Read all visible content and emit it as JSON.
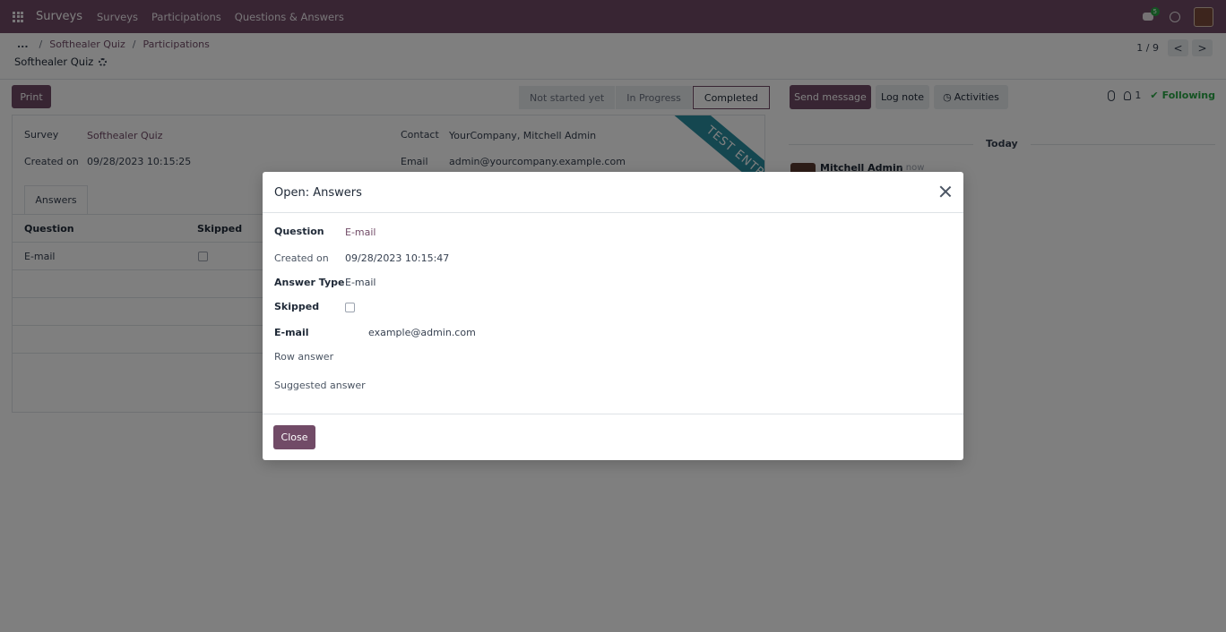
{
  "navbar": {
    "brand": "Surveys",
    "menu": [
      "Surveys",
      "Participations",
      "Questions & Answers"
    ],
    "messages_badge": "5"
  },
  "breadcrumb": {
    "dots": "...",
    "items": [
      "Softhealer Quiz",
      "Participations"
    ]
  },
  "record": {
    "title": "Softhealer Quiz"
  },
  "pager": {
    "value": "1 / 9",
    "prev": "<",
    "next": ">"
  },
  "actions": {
    "print": "Print"
  },
  "statusbar": {
    "stages": [
      "Not started yet",
      "In Progress",
      "Completed"
    ],
    "active": "Completed"
  },
  "form": {
    "survey_label": "Survey",
    "survey_value": "Softhealer Quiz",
    "created_label": "Created on",
    "created_value": "09/28/2023 10:15:25",
    "contact_label": "Contact",
    "contact_value": "YourCompany, Mitchell Admin",
    "email_label": "Email",
    "email_value": "admin@yourcompany.example.com",
    "ribbon": "TEST ENTRY",
    "tab": "Answers",
    "table": {
      "headers": [
        "Question",
        "Skipped"
      ],
      "rows": [
        {
          "question": "E-mail",
          "skipped": false
        }
      ]
    }
  },
  "chatter": {
    "send_message": "Send message",
    "log_note": "Log note",
    "activities": "Activities",
    "followers": "1",
    "following": "Following",
    "today": "Today",
    "author": "Mitchell Admin",
    "time": "- now"
  },
  "modal": {
    "title": "Open: Answers",
    "question_label": "Question",
    "question_value": "E-mail",
    "created_label": "Created on",
    "created_value": "09/28/2023 10:15:47",
    "answer_type_label": "Answer Type",
    "answer_type_value": "E-mail",
    "skipped_label": "Skipped",
    "email_label": "E-mail",
    "email_value": "example@admin.com",
    "row_answer_label": "Row answer",
    "suggested_label": "Suggested answer",
    "close": "Close"
  }
}
